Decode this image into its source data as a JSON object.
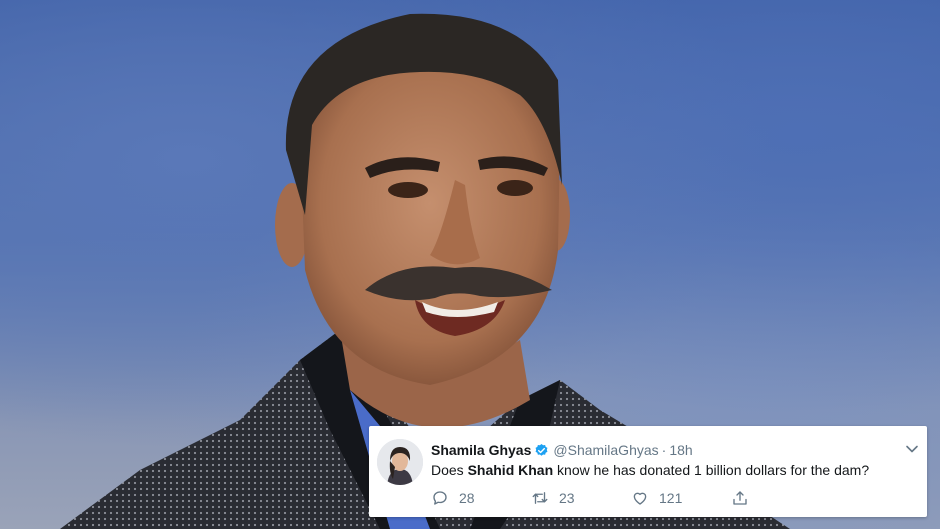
{
  "tweet": {
    "display_name": "Shamila Ghyas",
    "verified": true,
    "handle": "@ShamilaGhyas",
    "separator": "·",
    "time": "18h",
    "text_before": "Does ",
    "text_mention": "Shahid Khan",
    "text_after": " know he has donated 1 billion dollars for the dam?",
    "replies": "28",
    "retweets": "23",
    "likes": "121"
  },
  "icons": {
    "verified": "verified-badge-icon",
    "menu": "chevron-down-icon",
    "reply": "reply-icon",
    "retweet": "retweet-icon",
    "like": "heart-icon",
    "share": "share-icon"
  },
  "colors": {
    "verified_blue": "#1da1f2",
    "muted_text": "#657786",
    "primary_text": "#14171a"
  }
}
